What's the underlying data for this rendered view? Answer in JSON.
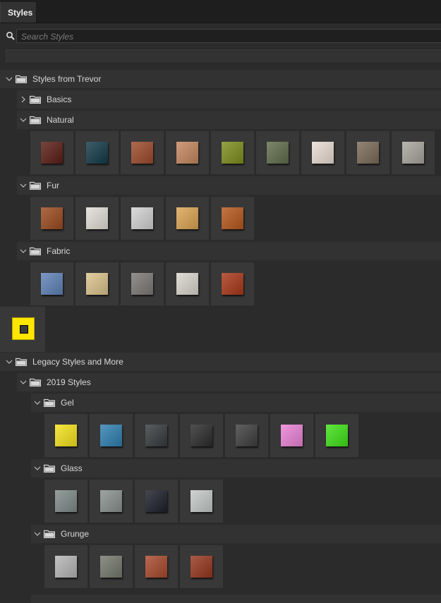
{
  "panel": {
    "tab_label": "Styles"
  },
  "search": {
    "placeholder": "Search Styles"
  },
  "tree": {
    "trevor": "Styles from Trevor",
    "basics": "Basics",
    "natural": "Natural",
    "fur": "Fur",
    "fabric": "Fabric",
    "legacy": "Legacy Styles and More",
    "y2019": "2019 Styles",
    "gel": "Gel",
    "glass": "Glass",
    "grunge": "Grunge"
  },
  "swatches": {
    "natural": [
      {
        "name": "dark-red-wood-style",
        "color": "#5a1d14"
      },
      {
        "name": "teal-stone-style",
        "color": "#123a48"
      },
      {
        "name": "orange-wood-style",
        "color": "#9c4a2c"
      },
      {
        "name": "wood-planks-style",
        "color": "#c4875e"
      },
      {
        "name": "moss-style",
        "color": "#7d8d1c"
      },
      {
        "name": "camo-stone-style",
        "color": "#5f6c4b"
      },
      {
        "name": "marble-style",
        "color": "#e9ddd2"
      },
      {
        "name": "gravel-style",
        "color": "#7b6a58"
      },
      {
        "name": "pyramid-metal-style",
        "color": "#a8a69c"
      }
    ],
    "fur": [
      {
        "name": "fox-fur-style",
        "color": "#9a4a1e"
      },
      {
        "name": "white-fur-style",
        "color": "#e2ddd6"
      },
      {
        "name": "zebra-style",
        "color": "#d2d2d2"
      },
      {
        "name": "leopard-style",
        "color": "#dca452"
      },
      {
        "name": "tiger-style",
        "color": "#b6571c"
      }
    ],
    "fabric": [
      {
        "name": "denim-style",
        "color": "#5f82b8"
      },
      {
        "name": "canvas-style",
        "color": "#dbc38b"
      },
      {
        "name": "grey-felt-style",
        "color": "#7c7876"
      },
      {
        "name": "linen-style",
        "color": "#d9d6cd"
      },
      {
        "name": "red-leather-style",
        "color": "#a9371a"
      }
    ],
    "gel": [
      {
        "name": "yellow-gel-style",
        "color": "#f5e21c"
      },
      {
        "name": "blue-crystal-style",
        "color": "#2f7fb0"
      },
      {
        "name": "dark-marble-style",
        "color": "#363a3c"
      },
      {
        "name": "black-gel-style",
        "color": "#2b2b2b"
      },
      {
        "name": "dark-grey-gel-style",
        "color": "#3e3e3e"
      },
      {
        "name": "pink-gel-style",
        "color": "#ea82d6"
      },
      {
        "name": "green-gel-style",
        "color": "#3fe118"
      }
    ],
    "glass": [
      {
        "name": "clear-glass-style",
        "color": "#7e8a87"
      },
      {
        "name": "frosted-glass-style",
        "color": "#88918e"
      },
      {
        "name": "black-glass-style",
        "color": "#1d1f2a"
      },
      {
        "name": "crackle-glass-style",
        "color": "#c5c9c8"
      }
    ],
    "grunge": [
      {
        "name": "silver-grunge-style",
        "color": "#b5b5b5"
      },
      {
        "name": "green-grunge-style",
        "color": "#75786d"
      },
      {
        "name": "brick-style",
        "color": "#a8482c"
      },
      {
        "name": "rust-style",
        "color": "#96361e"
      }
    ]
  },
  "selected_swatch": {
    "name": "selected-style",
    "color": "#ffe600"
  }
}
